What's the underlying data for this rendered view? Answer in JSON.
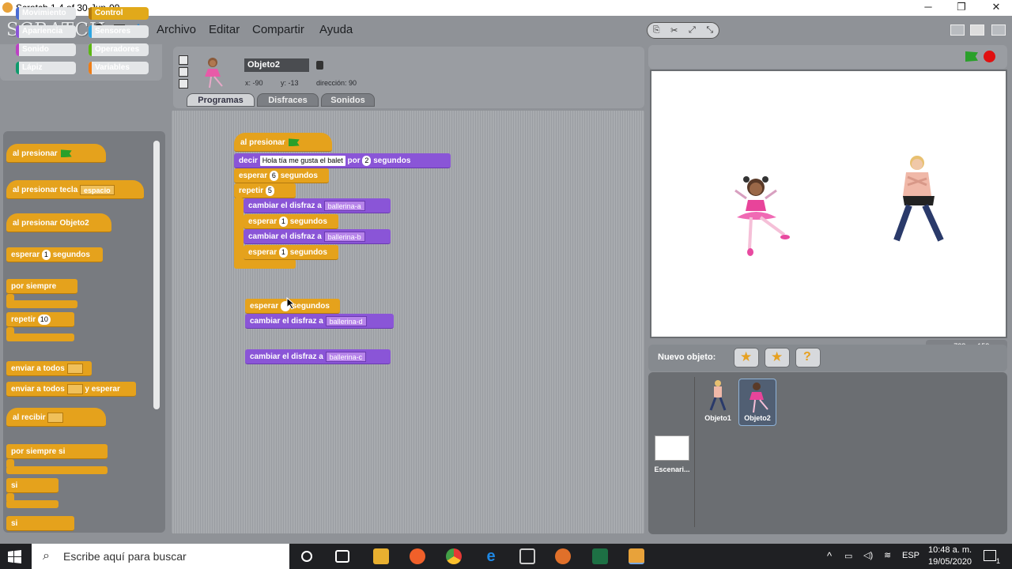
{
  "window": {
    "title": "Scratch 1.4 of 30-Jun-09",
    "minimize": "─",
    "restore": "❐",
    "close": "✕"
  },
  "menubar": {
    "logo": "SCRATCH",
    "items": [
      "Archivo",
      "Editar",
      "Compartir",
      "Ayuda"
    ]
  },
  "categories": [
    {
      "label": "Movimiento",
      "color": "#4a6cd4"
    },
    {
      "label": "Control",
      "color": "#e1a91a",
      "selected": true
    },
    {
      "label": "Apariencia",
      "color": "#8a55d7"
    },
    {
      "label": "Sensores",
      "color": "#2ca5e2"
    },
    {
      "label": "Sonido",
      "color": "#bb42c3"
    },
    {
      "label": "Operadores",
      "color": "#5cb712"
    },
    {
      "label": "Lápiz",
      "color": "#0e9a6c"
    },
    {
      "label": "Variables",
      "color": "#ee7d16"
    }
  ],
  "palette": {
    "b1": "al presionar",
    "b2": "al presionar tecla",
    "b2dd": "espacio",
    "b3": "al presionar Objeto2",
    "b4a": "esperar",
    "b4n": "1",
    "b4b": "segundos",
    "b5": "por siempre",
    "b6": "repetir",
    "b6n": "10",
    "b7": "enviar a todos",
    "b8a": "enviar a todos",
    "b8b": "y esperar",
    "b9": "al recibir",
    "b10": "por siempre si",
    "b11": "si",
    "b12": "si"
  },
  "sprite": {
    "name": "Objeto2",
    "x": "x: -90",
    "y": "y: -13",
    "dir": "dirección: 90"
  },
  "tabs": [
    "Programas",
    "Disfraces",
    "Sonidos"
  ],
  "script": {
    "hat": "al presionar",
    "say": "decir",
    "say_text": "Hola tía me gusta el balet",
    "por": "por",
    "say_n": "2",
    "segundos": "segundos",
    "wait1": "esperar",
    "wait1_n": "6",
    "repeat": "repetir",
    "repeat_n": "5",
    "cos1": "cambiar el disfraz a",
    "cos1_v": "ballerina-a",
    "w2": "esperar",
    "w2_n": "1",
    "cos2": "cambiar el disfraz a",
    "cos2_v": "ballerina-b",
    "w3": "esperar",
    "w3_n": "1",
    "loose_wait": "esperar",
    "loose_seg": "segundos",
    "loose_cos1": "cambiar el disfraz a",
    "loose_cos1_v": "ballerina-d",
    "loose_cos2": "cambiar el disfraz a",
    "loose_cos2_v": "ballerina-c"
  },
  "stage": {
    "coords": "x: -728   y: -152"
  },
  "newobject": {
    "label": "Nuevo objeto:"
  },
  "sprites": [
    {
      "label": "Objeto1"
    },
    {
      "label": "Objeto2",
      "selected": true
    }
  ],
  "stage_thumb": {
    "label": "Escenari..."
  },
  "taskbar": {
    "search_placeholder": "Escribe aquí para buscar",
    "time": "10:48 a. m.",
    "date": "19/05/2020",
    "lang": "ESP",
    "notif": "1"
  }
}
